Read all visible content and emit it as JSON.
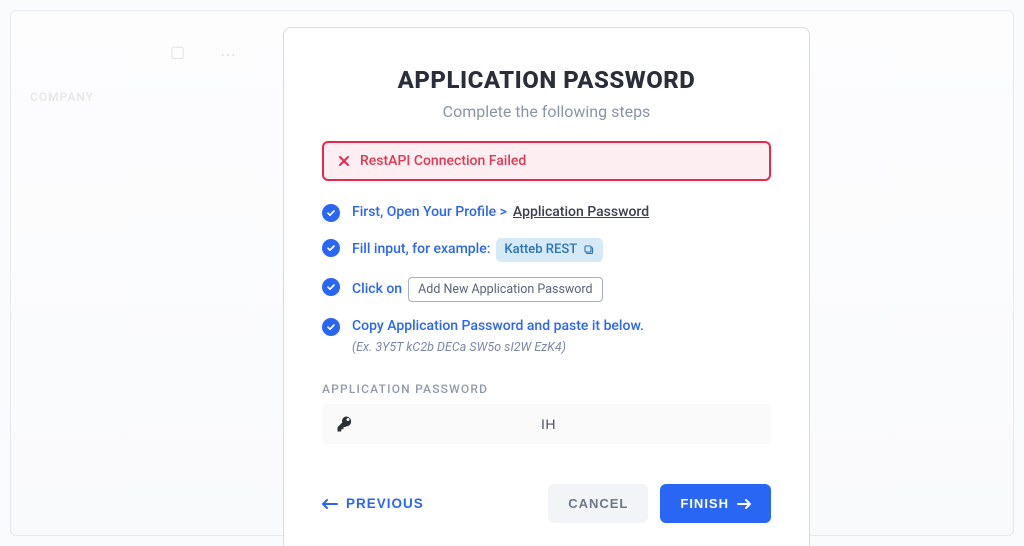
{
  "background": {
    "sidebar_label": "COMPANY"
  },
  "modal": {
    "title": "APPLICATION PASSWORD",
    "subtitle": "Complete the following steps",
    "alert": {
      "message": "RestAPI Connection Failed"
    },
    "steps": {
      "s1": {
        "prefix": "First, Open Your Profile > ",
        "link": "Application Password"
      },
      "s2": {
        "prefix": "Fill input, for example:",
        "pill": "Katteb REST"
      },
      "s3": {
        "prefix": "Click on",
        "button_label": "Add New Application Password"
      },
      "s4": {
        "line": "Copy Application Password and paste it below.",
        "example": "(Ex. 3Y5T kC2b DECa SW5o sI2W EzK4)"
      }
    },
    "field": {
      "label": "APPLICATION PASSWORD",
      "value": "IH"
    },
    "footer": {
      "previous": "PREVIOUS",
      "cancel": "CANCEL",
      "finish": "FINISH"
    }
  }
}
